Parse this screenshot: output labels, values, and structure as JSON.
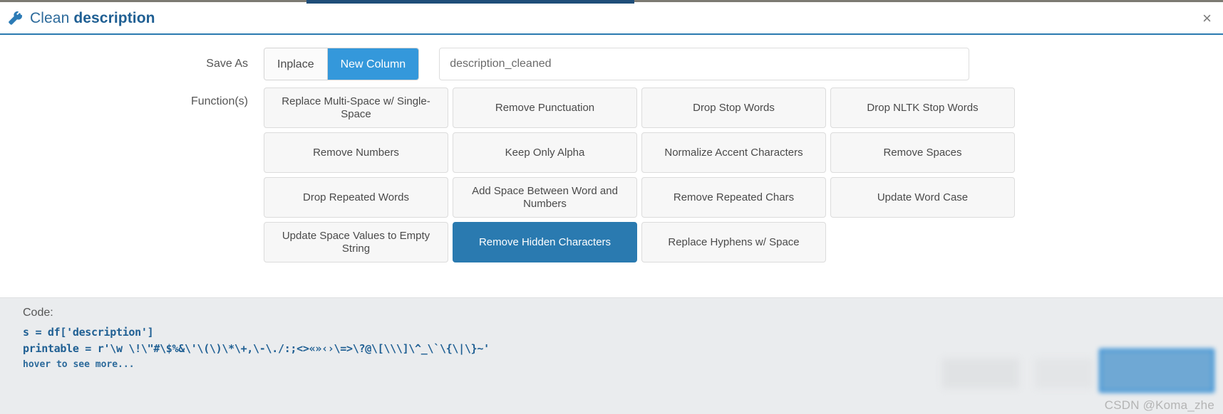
{
  "background": {
    "navbar_strip_color": "#1f4e79"
  },
  "header": {
    "icon": "wrench-icon",
    "title_prefix": "Clean ",
    "title_column": "description",
    "close_label": "×"
  },
  "save_as": {
    "label": "Save As",
    "options": [
      "Inplace",
      "New Column"
    ],
    "selected": "New Column",
    "input_value": "description_cleaned",
    "input_placeholder": "description_cleaned"
  },
  "functions": {
    "label": "Function(s)",
    "items": [
      {
        "label": "Replace Multi-Space w/ Single-Space",
        "selected": false
      },
      {
        "label": "Remove Punctuation",
        "selected": false
      },
      {
        "label": "Drop Stop Words",
        "selected": false
      },
      {
        "label": "Drop NLTK Stop Words",
        "selected": false
      },
      {
        "label": "Remove Numbers",
        "selected": false
      },
      {
        "label": "Keep Only Alpha",
        "selected": false
      },
      {
        "label": "Normalize Accent Characters",
        "selected": false
      },
      {
        "label": "Remove Spaces",
        "selected": false
      },
      {
        "label": "Drop Repeated Words",
        "selected": false
      },
      {
        "label": "Add Space Between Word and Numbers",
        "selected": false
      },
      {
        "label": "Remove Repeated Chars",
        "selected": false
      },
      {
        "label": "Update Word Case",
        "selected": false
      },
      {
        "label": "Update Space Values to Empty String",
        "selected": false
      },
      {
        "label": "Remove Hidden Characters",
        "selected": true
      },
      {
        "label": "Replace Hyphens w/ Space",
        "selected": false
      }
    ],
    "selected_color": "#2a7ab0"
  },
  "code": {
    "label": "Code:",
    "line1": "s = df['description']",
    "line2": "printable = r'\\w \\!\\\"#\\$%&\\'\\(\\)\\*\\+,\\-\\./:;<>«»‹›\\=>\\?@\\[\\\\\\]\\^_\\`\\{\\|\\}~'",
    "hover_hint": "hover to see more..."
  },
  "watermark": {
    "text": "CSDN @Koma_zhe"
  }
}
